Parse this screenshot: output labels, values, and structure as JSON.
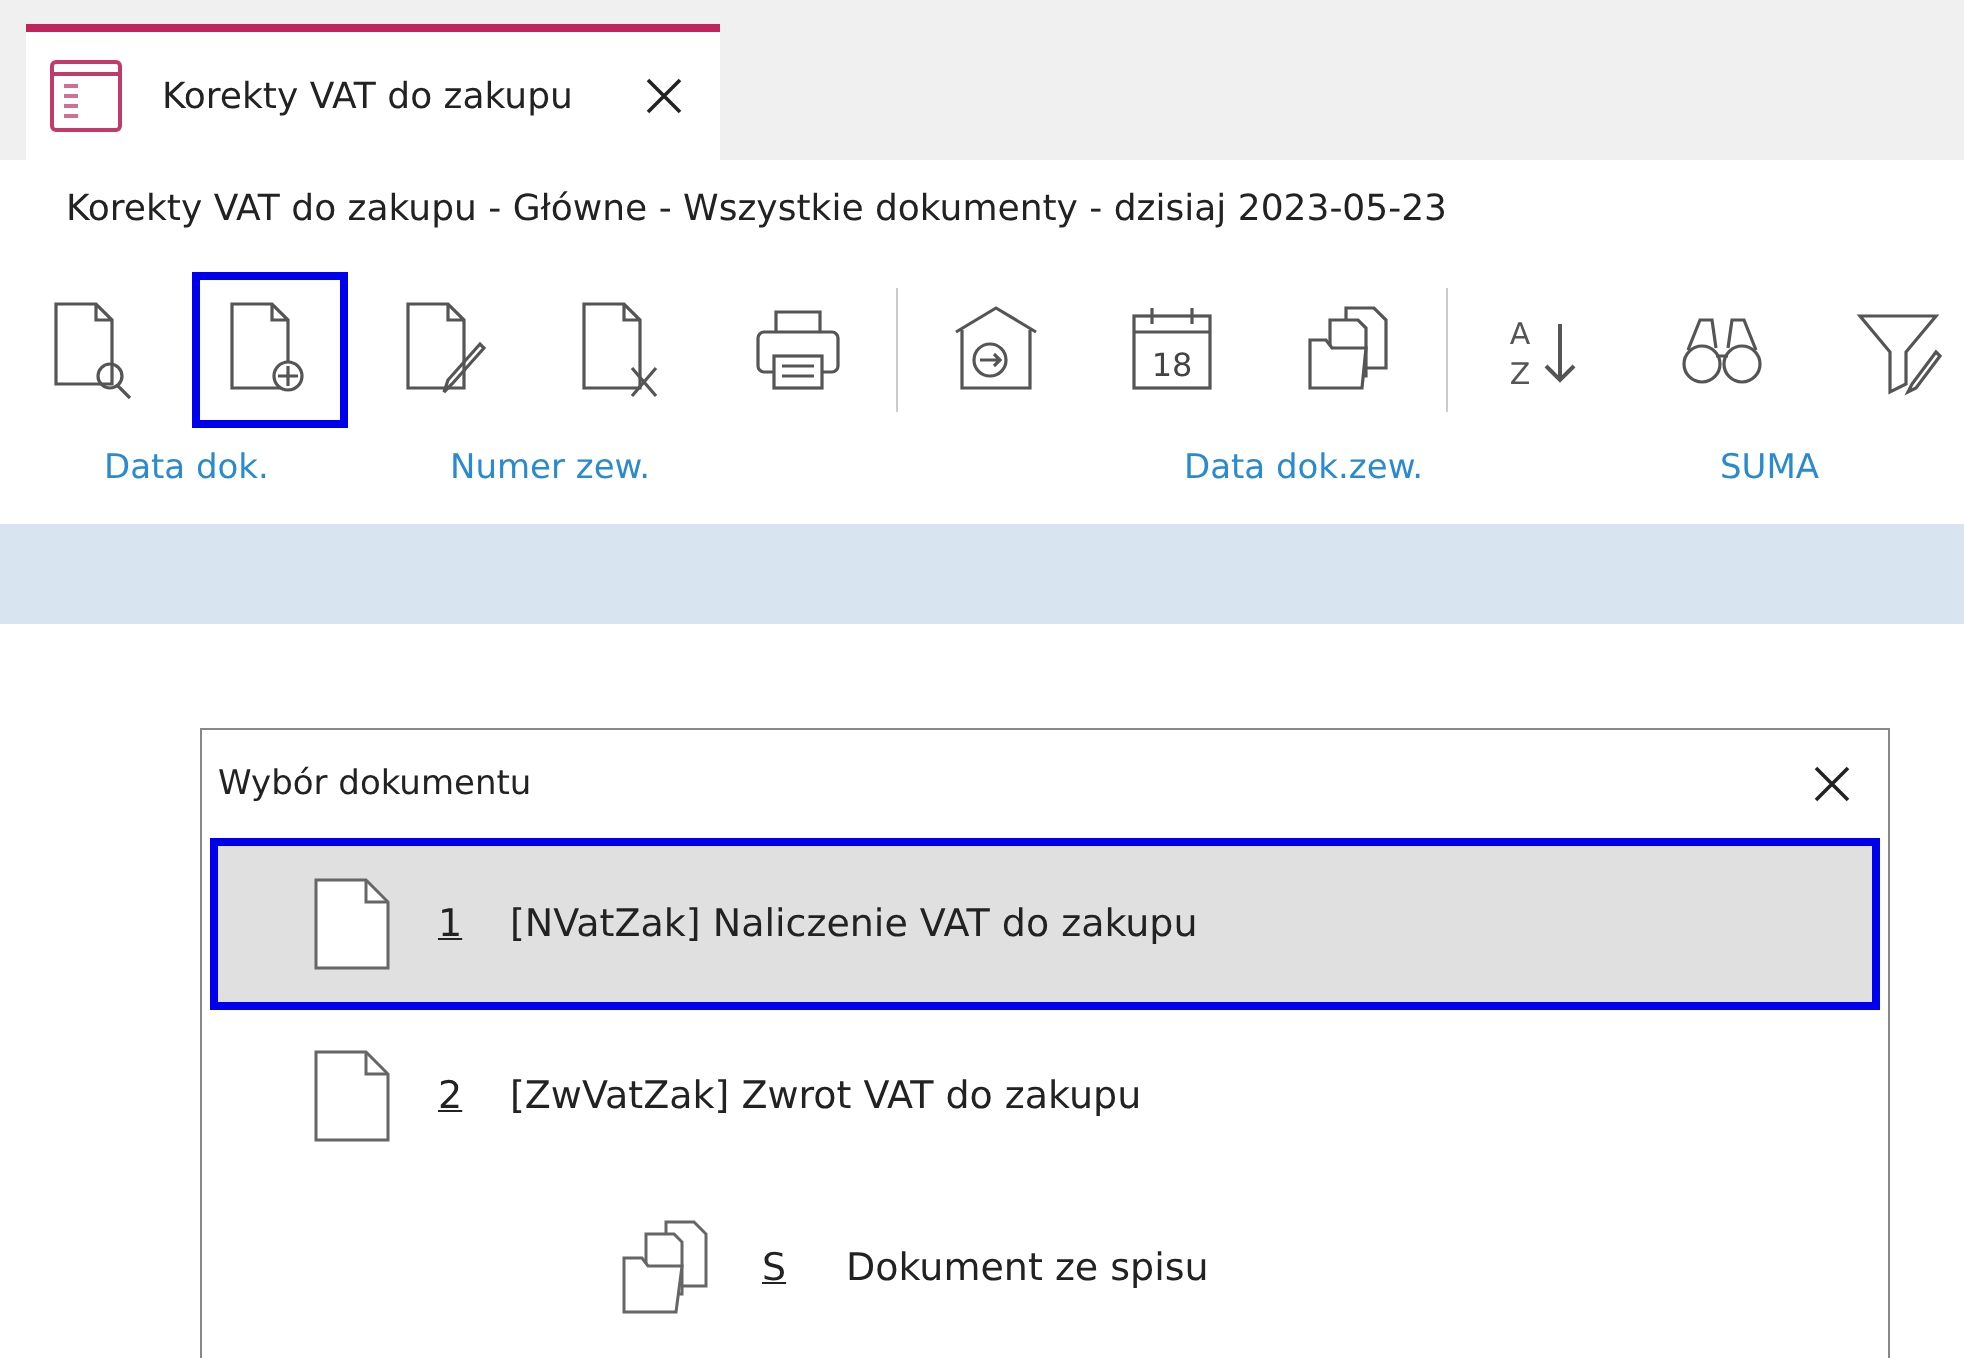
{
  "tab": {
    "title": "Korekty VAT do zakupu",
    "selected": true
  },
  "heading": "Korekty VAT do zakupu - Główne - Wszystkie dokumenty - dzisiaj 2023-05-23",
  "toolbar": {
    "groups": [
      [
        {
          "kind": "doc-search",
          "focused": false
        },
        {
          "kind": "doc-add",
          "focused": true
        },
        {
          "kind": "doc-edit",
          "focused": false
        },
        {
          "kind": "doc-delete",
          "focused": false
        },
        {
          "kind": "print",
          "focused": false
        }
      ],
      [
        {
          "kind": "import",
          "focused": false
        },
        {
          "kind": "calendar",
          "text": "18",
          "focused": false
        },
        {
          "kind": "folder",
          "focused": false
        }
      ],
      [
        {
          "kind": "sort",
          "text": "A",
          "text2": "Z",
          "focused": false
        },
        {
          "kind": "find",
          "focused": false
        },
        {
          "kind": "filter",
          "focused": false
        }
      ]
    ]
  },
  "columns": [
    "Data dok.",
    "Numer zew.",
    "Data dok.zew.",
    "SUMA"
  ],
  "dialog": {
    "title": "Wybór dokumentu",
    "items": [
      {
        "kind": "document",
        "key": "1",
        "label": "[NVatZak] Naliczenie VAT do zakupu",
        "selected": true
      },
      {
        "kind": "document",
        "key": "2",
        "label": "[ZwVatZak] Zwrot VAT do zakupu",
        "selected": false
      },
      {
        "kind": "folder",
        "key": "S",
        "label": "Dokument ze spisu",
        "selected": false
      }
    ]
  }
}
